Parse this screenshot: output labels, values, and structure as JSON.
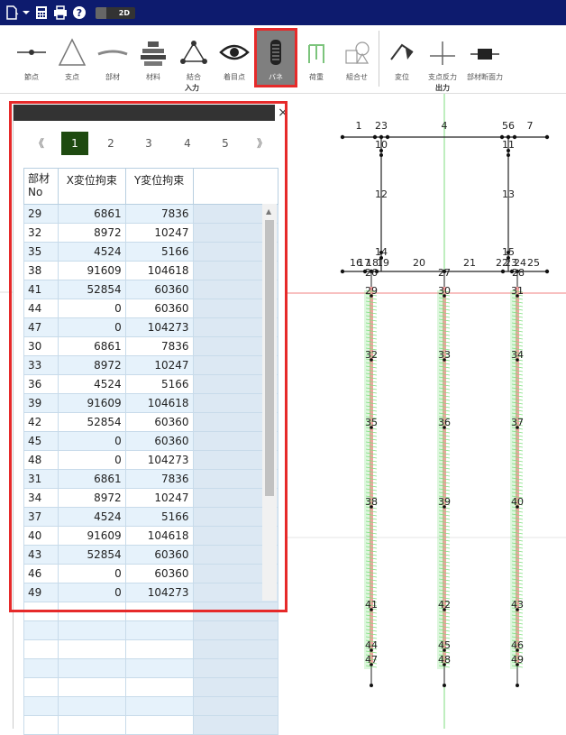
{
  "toolbar": {
    "mode_label": "2D"
  },
  "ribbon": {
    "items": [
      {
        "label": "節点",
        "icon": "node-icon"
      },
      {
        "label": "支点",
        "icon": "support-icon"
      },
      {
        "label": "部材",
        "icon": "member-icon"
      },
      {
        "label": "材料",
        "icon": "material-icon"
      },
      {
        "label": "結合",
        "icon": "joint-icon"
      },
      {
        "label": "着目点",
        "icon": "eye-icon"
      },
      {
        "label": "バネ",
        "icon": "spring-icon"
      },
      {
        "label": "荷重",
        "icon": "load-icon"
      },
      {
        "label": "組合せ",
        "icon": "combination-icon"
      },
      {
        "label": "変位",
        "icon": "displacement-icon"
      },
      {
        "label": "支点反力",
        "icon": "reaction-icon"
      },
      {
        "label": "部材断面力",
        "icon": "section-force-icon"
      }
    ],
    "input_group": "入力",
    "output_group": "出力"
  },
  "pager": {
    "first": "《",
    "pages": [
      "1",
      "2",
      "3",
      "4",
      "5"
    ],
    "last": "》",
    "current": "1"
  },
  "table": {
    "headers": [
      "部材\nNo",
      "X変位拘束",
      "Y変位拘束"
    ],
    "rows": [
      [
        "29",
        "6861",
        "7836"
      ],
      [
        "32",
        "8972",
        "10247"
      ],
      [
        "35",
        "4524",
        "5166"
      ],
      [
        "38",
        "91609",
        "104618"
      ],
      [
        "41",
        "52854",
        "60360"
      ],
      [
        "44",
        "0",
        "60360"
      ],
      [
        "47",
        "0",
        "104273"
      ],
      [
        "30",
        "6861",
        "7836"
      ],
      [
        "33",
        "8972",
        "10247"
      ],
      [
        "36",
        "4524",
        "5166"
      ],
      [
        "39",
        "91609",
        "104618"
      ],
      [
        "42",
        "52854",
        "60360"
      ],
      [
        "45",
        "0",
        "60360"
      ],
      [
        "48",
        "0",
        "104273"
      ],
      [
        "31",
        "6861",
        "7836"
      ],
      [
        "34",
        "8972",
        "10247"
      ],
      [
        "37",
        "4524",
        "5166"
      ],
      [
        "40",
        "91609",
        "104618"
      ],
      [
        "43",
        "52854",
        "60360"
      ],
      [
        "46",
        "0",
        "60360"
      ],
      [
        "49",
        "0",
        "104273"
      ],
      [
        "",
        "",
        ""
      ],
      [
        "",
        "",
        ""
      ],
      [
        "",
        "",
        ""
      ],
      [
        "",
        "",
        ""
      ],
      [
        "",
        "",
        ""
      ],
      [
        "",
        "",
        ""
      ],
      [
        "",
        "",
        ""
      ]
    ]
  },
  "model": {
    "top_labels": [
      "1",
      "23",
      "4",
      "56",
      "7"
    ],
    "upper_labels": [
      "10",
      "11",
      "12",
      "13",
      "14",
      "15"
    ],
    "beam_labels": [
      "16",
      "17",
      "18",
      "19",
      "20",
      "21",
      "22",
      "23",
      "24",
      "25",
      "26",
      "27",
      "28"
    ],
    "pile_labels": [
      [
        "29",
        "32",
        "35",
        "38",
        "41",
        "44",
        "47"
      ],
      [
        "30",
        "33",
        "36",
        "39",
        "42",
        "45",
        "48"
      ],
      [
        "31",
        "34",
        "37",
        "40",
        "43",
        "46",
        "49"
      ]
    ]
  }
}
